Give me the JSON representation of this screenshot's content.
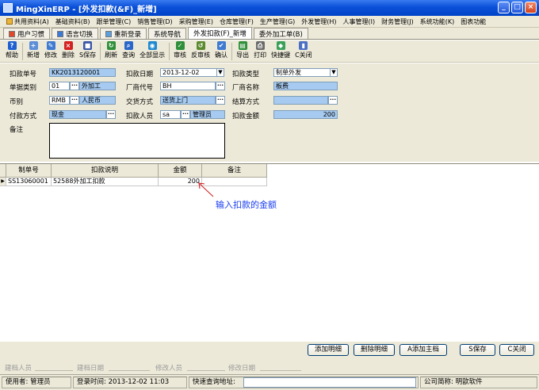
{
  "window": {
    "title": "MingXinERP - [外发扣款(&F)_新增]",
    "controls": [
      "_",
      "□",
      "×"
    ]
  },
  "menu": {
    "items": [
      "共用资料(A)",
      "基础资料(B)",
      "跟单管理(C)",
      "销售管理(D)",
      "采购管理(E)",
      "仓库管理(F)",
      "生产管理(G)",
      "外发管理(H)",
      "人事管理(I)",
      "财务管理(J)",
      "系统功能(K)",
      "图表功能"
    ]
  },
  "tabs": {
    "items": [
      "用户习惯",
      "语言切换",
      "重新登录",
      "系统导航",
      "外发扣款(F)_新增",
      "委外加工单(B)"
    ]
  },
  "toolbar": {
    "buttons": [
      {
        "label": "帮助",
        "icon": "help-icon",
        "color": "#1f5fd1",
        "glyph": "?"
      },
      {
        "label": "新增",
        "icon": "new-icon",
        "color": "#5d8fd8",
        "glyph": "+"
      },
      {
        "label": "修改",
        "icon": "edit-icon",
        "color": "#3f7bd1",
        "glyph": "✎"
      },
      {
        "label": "删除",
        "icon": "delete-icon",
        "color": "#d42020",
        "glyph": "×"
      },
      {
        "label": "S保存",
        "icon": "save-icon",
        "color": "#3a56a8",
        "glyph": "■"
      },
      {
        "label": "刷新",
        "icon": "refresh-icon",
        "color": "#2f8f3a",
        "glyph": "↻"
      },
      {
        "label": "查询",
        "icon": "query-icon",
        "color": "#2a67c8",
        "glyph": "⌕"
      },
      {
        "label": "全部显示",
        "icon": "show-all-icon",
        "color": "#1e88d0",
        "glyph": "◉"
      },
      {
        "label": "审核",
        "icon": "approve-icon",
        "color": "#2f8f3a",
        "glyph": "✓"
      },
      {
        "label": "反审核",
        "icon": "unapprove-icon",
        "color": "#5c8a2f",
        "glyph": "↺"
      },
      {
        "label": "确认",
        "icon": "confirm-icon",
        "color": "#3f7bd1",
        "glyph": "✔"
      },
      {
        "label": "导出",
        "icon": "export-icon",
        "color": "#2f8f3a",
        "glyph": "▤"
      },
      {
        "label": "打印",
        "icon": "print-icon",
        "color": "#6a6a6a",
        "glyph": "⎙"
      },
      {
        "label": "快捷键",
        "icon": "shortcut-icon",
        "color": "#3aa05a",
        "glyph": "◆"
      },
      {
        "label": "C关闭",
        "icon": "close-doc-icon",
        "color": "#4a6fc4",
        "glyph": "▮"
      }
    ]
  },
  "form": {
    "labels": {
      "doc_no": "扣款单号",
      "doc_type": "单据类别",
      "currency": "币别",
      "pay_method": "付款方式",
      "remark": "备注",
      "deduct_date": "扣款日期",
      "vendor_code": "厂商代号",
      "delivery": "交货方式",
      "deduct_person": "扣款人员",
      "deduct_type": "扣款类型",
      "vendor_name": "厂商名称",
      "settle": "结算方式",
      "deduct_amount": "扣款金额"
    },
    "values": {
      "doc_no": "KK2013120001",
      "doc_type_code": "01",
      "doc_type_name": "外加工",
      "currency_code": "RMB",
      "currency_name": "人民币",
      "pay_method": "现金",
      "remark": "",
      "deduct_date": "2013-12-02",
      "vendor_code": "BH",
      "delivery": "送货上门",
      "deduct_person_code": "sa",
      "deduct_person_name": "管理员",
      "deduct_type": "制单外发",
      "vendor_name": "板费",
      "settle": "",
      "deduct_amount": "200"
    },
    "dots": "···",
    "dropdown": "▼"
  },
  "grid": {
    "columns": [
      "制单号",
      "扣款说明",
      "金额",
      "备注"
    ],
    "rows": [
      {
        "order_no": "SS13060001",
        "desc": "52588外加工扣款",
        "amount": "200",
        "note": ""
      }
    ],
    "row_marker": "▶"
  },
  "annotation": {
    "text": "输入扣款的金额",
    "color": "#1a3ef0"
  },
  "buttons": {
    "add_detail": "添加明细",
    "delete_detail": "删除明细",
    "add_master": "A添加主档",
    "save": "S保存",
    "close": "C关闭"
  },
  "audit": {
    "creator": "建档人员",
    "create_date": "建档日期",
    "modifier": "修改人员",
    "modify_date": "修改日期"
  },
  "statusbar": {
    "user": "使用者: 管理员",
    "login_time": "登录时间: 2013-12-02 11:03",
    "quick_query": "快速查询地址:",
    "company": "公司简称: 明歆软件"
  }
}
